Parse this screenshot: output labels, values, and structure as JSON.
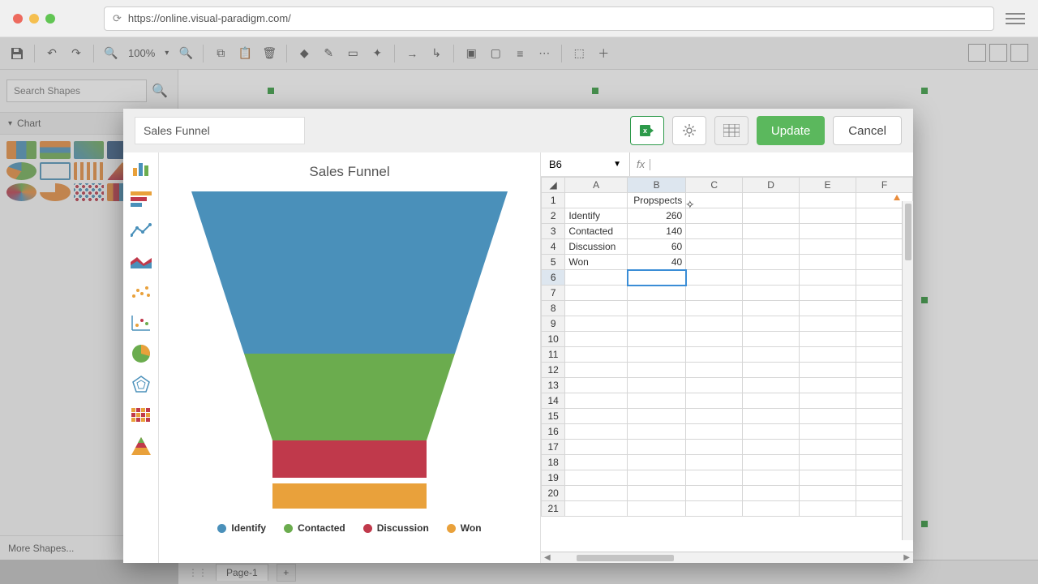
{
  "browser": {
    "url": "https://online.visual-paradigm.com/"
  },
  "toolbar": {
    "zoom": "100%"
  },
  "sidebar": {
    "search_placeholder": "Search Shapes",
    "chart_label": "Chart",
    "more_shapes": "More Shapes..."
  },
  "page_tabs": {
    "page1": "Page-1"
  },
  "dialog": {
    "title_value": "Sales Funnel",
    "update": "Update",
    "cancel": "Cancel"
  },
  "chart_data": {
    "type": "funnel",
    "title": "Sales Funnel",
    "series_name": "Propspects",
    "categories": [
      "Identify",
      "Contacted",
      "Discussion",
      "Won"
    ],
    "values": [
      260,
      140,
      60,
      40
    ],
    "colors": [
      "#4a90ba",
      "#6bac4e",
      "#c0394b",
      "#e9a13b"
    ]
  },
  "sheet": {
    "active_cell": "B6",
    "fx": "fx",
    "columns": [
      "A",
      "B",
      "C",
      "D",
      "E",
      "F"
    ],
    "header_b1": "Propspects",
    "rows": [
      {
        "a": "Identify",
        "b": "260"
      },
      {
        "a": "Contacted",
        "b": "140"
      },
      {
        "a": "Discussion",
        "b": "60"
      },
      {
        "a": "Won",
        "b": "40"
      }
    ]
  }
}
